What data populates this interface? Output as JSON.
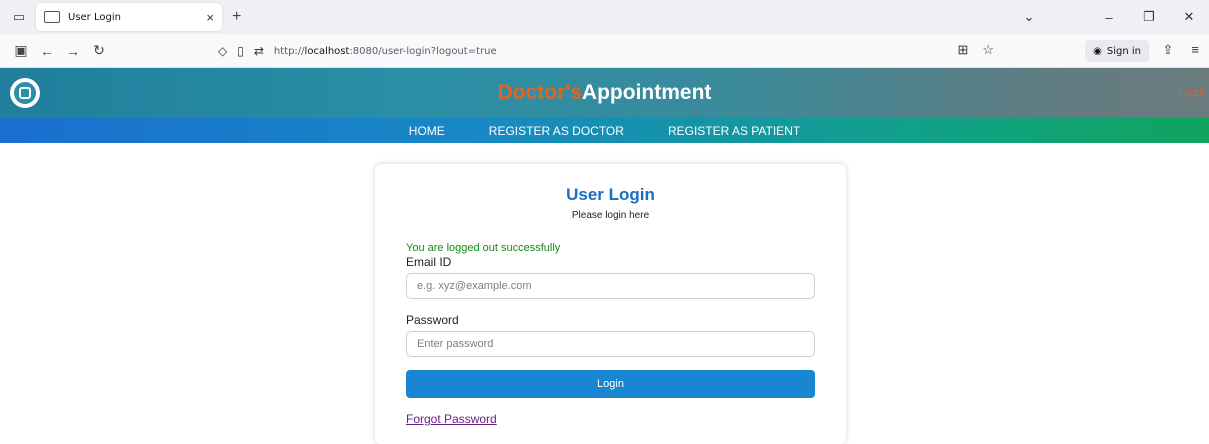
{
  "browser": {
    "tab_title": "User Login",
    "tab_close": "×",
    "new_tab": "+",
    "url_prefix": "http://",
    "url_host": "localhost",
    "url_rest": ":8080/user-login?logout=true",
    "signin_label": "Sign in"
  },
  "header": {
    "brand_part1": "Doctor's",
    "brand_part2": "Appointment",
    "login_link": "Login"
  },
  "nav": {
    "items": [
      "HOME",
      "REGISTER AS DOCTOR",
      "REGISTER AS PATIENT"
    ]
  },
  "login": {
    "title": "User Login",
    "subtitle": "Please login here",
    "message": "You are logged out successfully",
    "email_label": "Email ID",
    "email_placeholder": "e.g. xyz@example.com",
    "password_label": "Password",
    "password_placeholder": "Enter password",
    "button_label": "Login",
    "forgot_label": "Forgot Password"
  },
  "colors": {
    "brand_accent": "#e8621c",
    "title_blue": "#1a6fc4",
    "button_blue": "#1886d1",
    "success_green": "#188a18"
  }
}
